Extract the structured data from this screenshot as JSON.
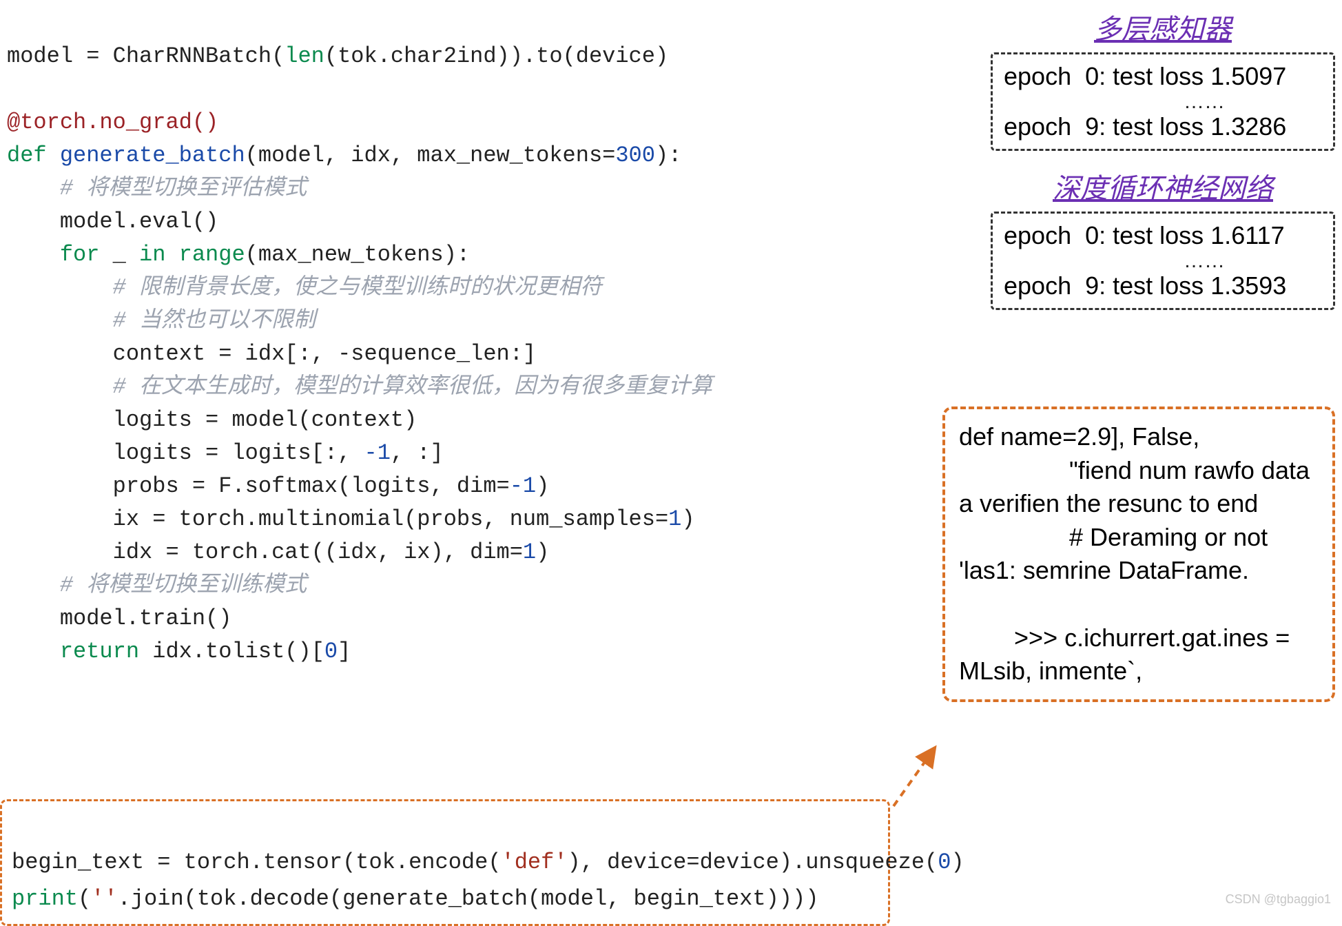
{
  "code_top": {
    "l1_a": "model = CharRNNBatch(",
    "l1_b": "len",
    "l1_c": "(tok.char2ind)).to(device)",
    "l3_dec": "@torch.no_grad()",
    "l4_def": "def",
    "l4_fn": " generate_batch",
    "l4_args_a": "(model, idx, max_new_tokens=",
    "l4_num": "300",
    "l4_args_b": "):",
    "l5_c": "    # 将模型切换至评估模式",
    "l6": "    model.eval()",
    "l7_for": "    for",
    "l7_rest_a": " _ ",
    "l7_in": "in",
    "l7_rest_b": " ",
    "l7_range": "range",
    "l7_rest_c": "(max_new_tokens):",
    "l8_c": "        # 限制背景长度，使之与模型训练时的状况更相符",
    "l9_c": "        # 当然也可以不限制",
    "l10": "        context = idx[:, -sequence_len:]",
    "l11_c": "        # 在文本生成时，模型的计算效率很低，因为有很多重复计算",
    "l12": "        logits = model(context)",
    "l13_a": "        logits = logits[:, ",
    "l13_n": "-1",
    "l13_b": ", :]",
    "l14_a": "        probs = F.softmax(logits, dim=",
    "l14_n": "-1",
    "l14_b": ")",
    "l15_a": "        ix = torch.multinomial(probs, num_samples=",
    "l15_n": "1",
    "l15_b": ")",
    "l16_a": "        idx = torch.cat((idx, ix), dim=",
    "l16_n": "1",
    "l16_b": ")",
    "l17_c": "    # 将模型切换至训练模式",
    "l18": "    model.train()",
    "l19_r": "    return",
    "l19_a": " idx.tolist()[",
    "l19_n": "0",
    "l19_b": "]"
  },
  "code_bottom": {
    "b1_a": "begin_text = torch.tensor(tok.encode(",
    "b1_s": "'def'",
    "b1_b": "), device=device).unsqueeze(",
    "b1_n": "0",
    "b1_c": ")",
    "b2_a": "print",
    "b2_b": "(",
    "b2_s": "''",
    "b2_c": ".join(tok.decode(generate_batch(model, begin_text))))"
  },
  "mlp": {
    "title": "多层感知器",
    "line1": "epoch  0: test loss 1.5097",
    "ellipsis": "……",
    "line2": "epoch  9: test loss 1.3286"
  },
  "rnn": {
    "title": "深度循环神经网络",
    "line1": "epoch  0: test loss 1.6117",
    "ellipsis": "……",
    "line2": "epoch  9: test loss 1.3593"
  },
  "output_text": "def name=2.9], False,\n                \"fiend num rawfo data a verifien the resunc to end\n                # Deraming or not 'las1: semrine DataFrame.\n\n        >>> c.ichurrert.gat.ines = MLsib, inmente`,",
  "watermark": "CSDN @tgbaggio1"
}
